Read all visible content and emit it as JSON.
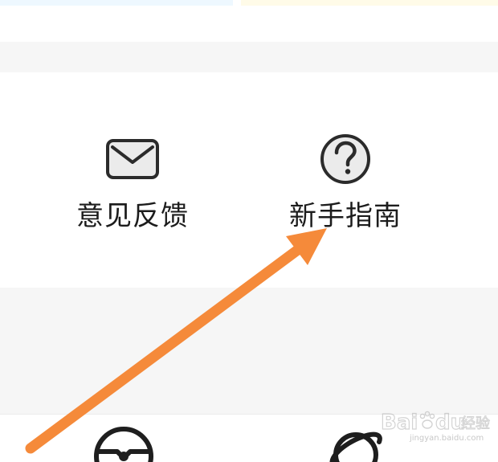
{
  "tools": [
    {
      "label": "意见反馈",
      "icon": "mail-icon"
    },
    {
      "label": "新手指南",
      "icon": "question-circle-icon"
    }
  ],
  "bottom_icons": [
    {
      "icon": "steering-wheel-icon"
    },
    {
      "icon": "planet-icon"
    }
  ],
  "annotation": {
    "color": "#f58a3a",
    "points_to": "新手指南"
  },
  "watermark": {
    "text": "jingyan.baidu.com",
    "logo": "Baidu经验"
  },
  "colors": {
    "background": "#f6f6f6",
    "card": "#ffffff",
    "text": "#1c1c1c",
    "icon_stroke": "#2b2b2b",
    "icon_fill": "#ebebeb"
  }
}
